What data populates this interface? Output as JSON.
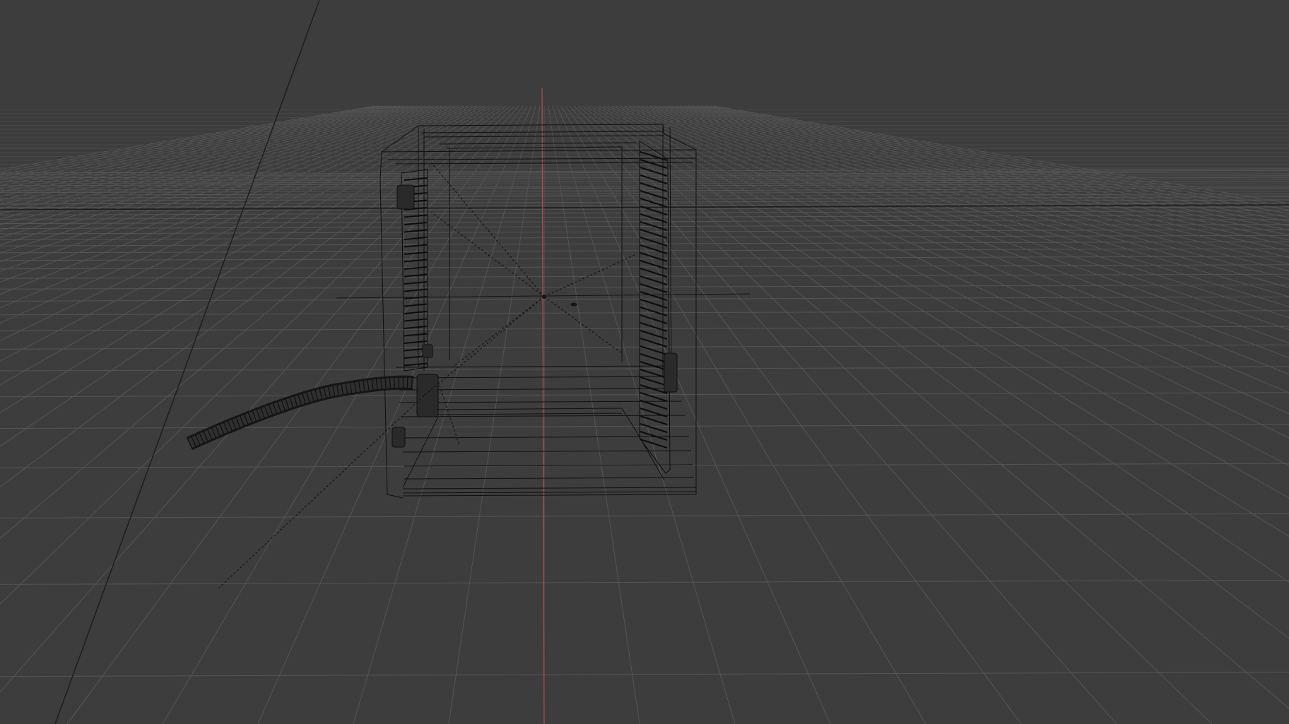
{
  "viewport": {
    "mode": "wireframe",
    "view": "perspective",
    "background": "#3d3d3d"
  },
  "colors": {
    "grid_line": "#555555",
    "horizon_line": "#1c1c1c",
    "z_axis": "#b5504d",
    "wireframe": "#0e0e0e"
  },
  "objects": [
    {
      "name": "cube-enclosure",
      "icon": "wireframe-cube"
    },
    {
      "name": "left-panel-vents",
      "icon": "vent-grille"
    },
    {
      "name": "right-panel-vents",
      "icon": "vent-grille"
    },
    {
      "name": "cable",
      "icon": "cable"
    },
    {
      "name": "object-origin",
      "icon": "crosshair-origin"
    }
  ]
}
